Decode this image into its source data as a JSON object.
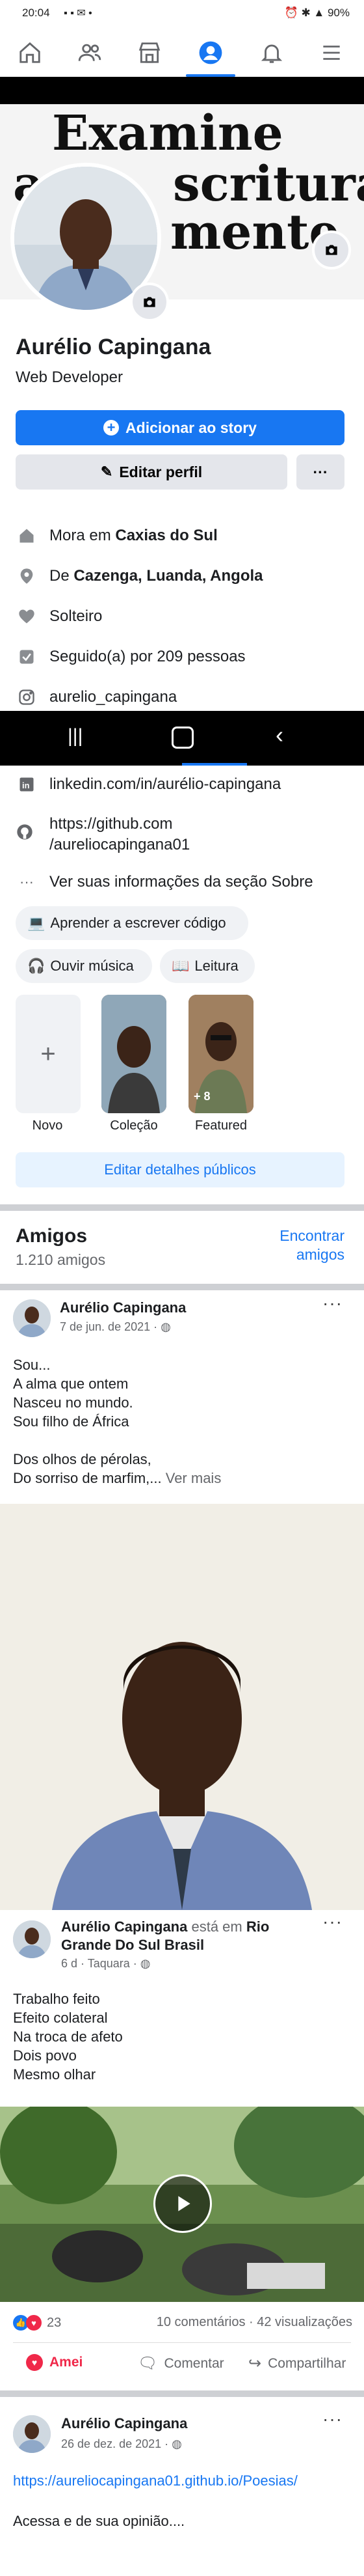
{
  "status_bar": {
    "time": "20:04",
    "battery": "90%"
  },
  "cover": {
    "line1": "Examine",
    "line2_left": "a",
    "line2_right": "scrituras",
    "line3": "mente"
  },
  "profile": {
    "name": "Aurélio Capingana",
    "headline": "Web Developer",
    "add_story_label": "Adicionar ao story",
    "edit_profile_label": "Editar perfil",
    "more_label": "···"
  },
  "intro": {
    "lives_prefix": "Mora em",
    "lives_city": "Caxias do Sul",
    "from_prefix": "De",
    "from_place": "Cazenga, Luanda, Angola",
    "relationship": "Solteiro",
    "followers": "Seguido(a) por 209 pessoas",
    "instagram": "aurelio_capingana",
    "linkedin": "linkedin.com/in/aurélio-capingana",
    "github_line1": "https://github.com",
    "github_line2": "/aureliocapingana01",
    "see_about": "Ver suas informações da seção Sobre"
  },
  "hobbies": [
    {
      "emoji": "💻",
      "label": "Aprender a escrever código"
    },
    {
      "emoji": "🎧",
      "label": "Ouvir música"
    },
    {
      "emoji": "📖",
      "label": "Leitura"
    }
  ],
  "featured": {
    "items": [
      {
        "label": "Novo"
      },
      {
        "label": "Coleção"
      },
      {
        "label": "Featured",
        "badge": "+ 8"
      }
    ],
    "edit_label": "Editar detalhes públicos"
  },
  "friends": {
    "title": "Amigos",
    "count": "1.210 amigos",
    "find_line1": "Encontrar",
    "find_line2": "amigos"
  },
  "posts": [
    {
      "author": "Aurélio Capingana",
      "date": "7 de jun. de 2021 ·",
      "lines": [
        "Sou...",
        "A alma que ontem",
        "Nasceu no mundo.",
        "Sou filho de África",
        "",
        "Dos olhos de pérolas,",
        "Do sorriso de marfim,..."
      ],
      "see_more": "Ver mais"
    },
    {
      "author": "Aurélio Capingana",
      "is_at": "está em",
      "place": "Rio Grande Do Sul Brasil",
      "date": "6 d · Taquara ·",
      "lines": [
        "Trabalho feito",
        "Efeito colateral",
        "Na troca de afeto",
        "Dois povo",
        "Mesmo olhar"
      ],
      "reactions_count": "23",
      "stats": "10 comentários · 42 visualizações",
      "actions": [
        "Amei",
        "Comentar",
        "Compartilhar"
      ]
    },
    {
      "author": "Aurélio Capingana",
      "date": "26 de dez. de 2021 ·",
      "link": "https://aureliocapingana01.github.io/Poesias/",
      "text": "Acessa e de sua opinião...."
    }
  ],
  "colors": {
    "accent": "#1877f2",
    "grey_button": "#e4e6eb",
    "love": "#f02849"
  }
}
